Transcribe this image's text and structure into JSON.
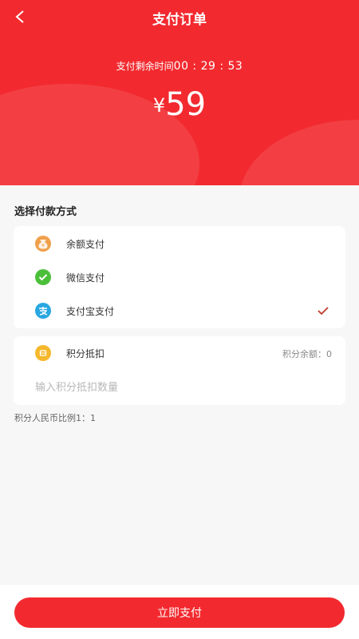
{
  "header": {
    "title": "支付订单",
    "countdown_label": "支付剩余时间",
    "countdown_time": "00 : 29 : 53",
    "currency": "¥",
    "amount": "59",
    "bg_color": "#f22a2f"
  },
  "payment": {
    "section_title": "选择付款方式",
    "methods": [
      {
        "label": "余额支付",
        "icon": "wallet-bag-icon",
        "color": "#f0a04b"
      },
      {
        "label": "微信支付",
        "icon": "wechat-icon",
        "color": "#4cbf3a"
      },
      {
        "label": "支付宝支付",
        "icon": "alipay-icon",
        "color": "#29a7e1",
        "selected": true
      }
    ],
    "check_icon": "checkmark-icon"
  },
  "points": {
    "label": "积分抵扣",
    "icon": "coin-icon",
    "balance_text": "积分余额：0",
    "input_placeholder": "输入积分抵扣数量",
    "ratio_text": "积分人民币比例1：1"
  },
  "footer": {
    "pay_button": "立即支付"
  }
}
